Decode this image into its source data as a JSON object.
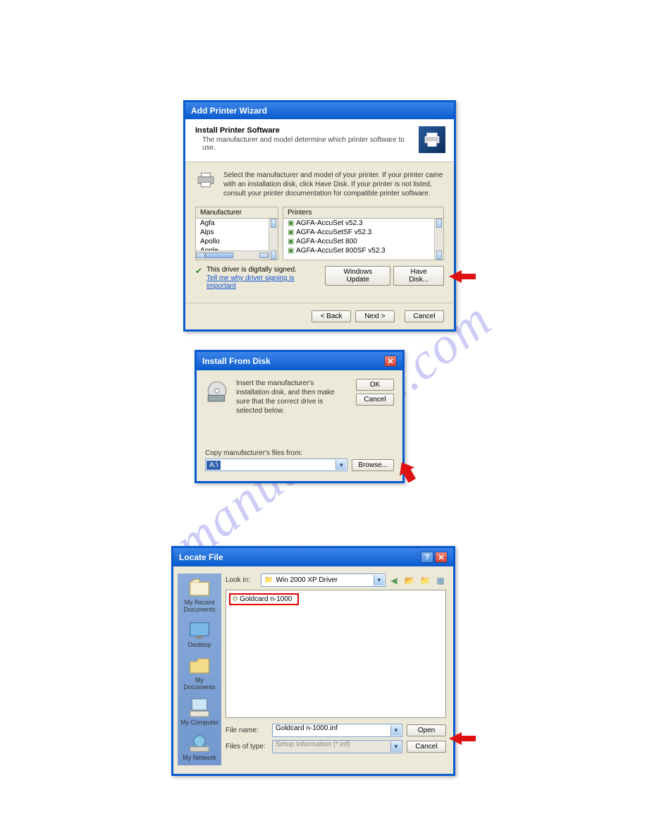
{
  "watermark": "manualshive.com",
  "dialog1": {
    "title": "Add Printer Wizard",
    "heading": "Install Printer Software",
    "subheading": "The manufacturer and model determine which printer software to use.",
    "instruction": "Select the manufacturer and model of your printer. If your printer came with an installation disk, click Have Disk. If your printer is not listed, consult your printer documentation for compatible printer software.",
    "col_manufacturer": "Manufacturer",
    "col_printers": "Printers",
    "manufacturers": [
      "Agfa",
      "Alps",
      "Apollo",
      "Apple"
    ],
    "printers": [
      "AGFA-AccuSet v52.3",
      "AGFA-AccuSetSF v52.3",
      "AGFA-AccuSet 800",
      "AGFA-AccuSet 800SF v52.3"
    ],
    "signed_text": "This driver is digitally signed.",
    "signed_link": "Tell me why driver signing is important",
    "windows_update": "Windows Update",
    "have_disk": "Have Disk...",
    "back": "< Back",
    "next": "Next >",
    "cancel": "Cancel"
  },
  "dialog2": {
    "title": "Install From Disk",
    "text": "Insert the manufacturer's installation disk, and then make sure that the correct drive is selected below.",
    "ok": "OK",
    "cancel": "Cancel",
    "copy_label": "Copy manufacturer's files from:",
    "path": "A:\\",
    "browse": "Browse..."
  },
  "dialog3": {
    "title": "Locate File",
    "look_in_label": "Look in:",
    "look_in_value": "Win 2000 XP Driver",
    "sidebar": {
      "recent": "My Recent Documents",
      "desktop": "Desktop",
      "mydocs": "My Documents",
      "mycomp": "My Computer",
      "mynet": "My Network"
    },
    "selected_file": "Goldcard n-1000",
    "filename_label": "File name:",
    "filename_value": "Goldcard n-1000.inf",
    "filetype_label": "Files of type:",
    "filetype_value": "Setup Information (*.inf)",
    "open": "Open",
    "cancel": "Cancel"
  }
}
